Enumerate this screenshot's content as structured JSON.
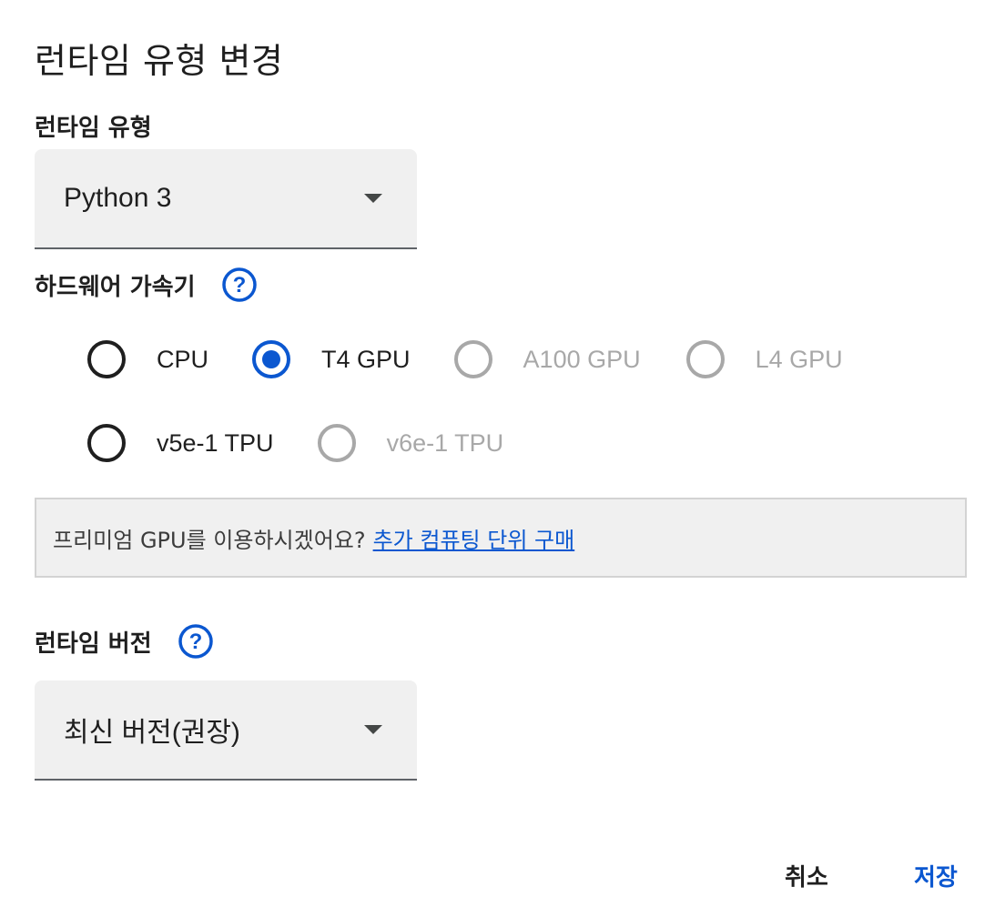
{
  "dialog": {
    "title": "런타임 유형 변경",
    "runtime_type": {
      "label": "런타임 유형",
      "value": "Python 3"
    },
    "hardware_accelerator": {
      "label": "하드웨어 가속기",
      "help_icon": "help-circle-icon",
      "options": [
        {
          "label": "CPU",
          "state": "unchecked"
        },
        {
          "label": "T4 GPU",
          "state": "checked"
        },
        {
          "label": "A100 GPU",
          "state": "disabled"
        },
        {
          "label": "L4 GPU",
          "state": "disabled"
        },
        {
          "label": "v5e-1 TPU",
          "state": "unchecked"
        },
        {
          "label": "v6e-1 TPU",
          "state": "disabled"
        }
      ]
    },
    "notice": {
      "text": "프리미엄 GPU를 이용하시겠어요?",
      "link": "추가 컴퓨팅 단위 구매"
    },
    "runtime_version": {
      "label": "런타임 버전",
      "help_icon": "help-circle-icon",
      "value": "최신 버전(권장)"
    },
    "buttons": {
      "cancel": "취소",
      "save": "저장"
    }
  },
  "colors": {
    "accent": "#0b57d0",
    "disabled": "#a8a8a8",
    "field_bg": "#f0f0f0"
  }
}
